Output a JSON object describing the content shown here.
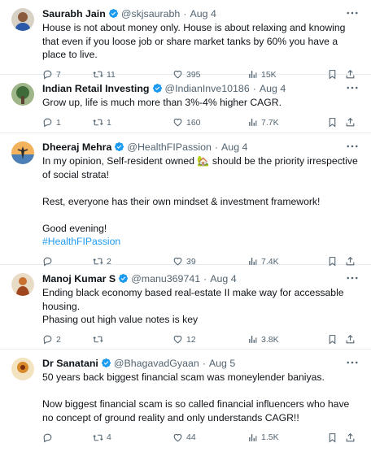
{
  "tweets": [
    {
      "name": "Saurabh Jain",
      "handle": "@skjsaurabh",
      "time": "Aug 4",
      "text": "House is not about money only. House is about relaxing and knowing that even if you loose job or share market tanks by 60% you have a place to live.",
      "replies": "7",
      "retweets": "11",
      "likes": "395",
      "views": "15K"
    },
    {
      "name": "Indian Retail Investing",
      "handle": "@IndianInve10186",
      "time": "Aug 4",
      "text": "Grow up, life is much more than 3%-4% higher CAGR.",
      "replies": "1",
      "retweets": "1",
      "likes": "160",
      "views": "7.7K"
    },
    {
      "name": "Dheeraj Mehra",
      "handle": "@HealthFIPassion",
      "time": "Aug 4",
      "text_part1": "In my opinion, Self-resident owned 🏡 should be the priority irrespective of social strata!\n\nRest, everyone has their own mindset & investment framework!\n\nGood evening!",
      "hashtag": "#HealthFIPassion",
      "replies": "",
      "retweets": "2",
      "likes": "39",
      "views": "7.4K"
    },
    {
      "name": "Manoj Kumar S",
      "handle": "@manu369741",
      "time": "Aug 4",
      "text": "Ending black economy based real-estate II make way for accessable housing.\nPhasing out high value notes is key",
      "replies": "2",
      "retweets": "",
      "likes": "12",
      "views": "3.8K"
    },
    {
      "name": "Dr Sanatani",
      "handle": "@BhagavadGyaan",
      "time": "Aug 5",
      "text": "50 years back biggest financial scam was moneylender baniyas.\n\nNow biggest financial scam is so called financial influencers who have no concept of ground reality and only understands CAGR!!",
      "replies": "",
      "retweets": "4",
      "likes": "44",
      "views": "1.5K"
    }
  ],
  "dot": "·",
  "colors": {
    "verified": "#1d9bf0",
    "muted": "#536471",
    "link": "#1d9bf0",
    "divider": "#e6ecf0"
  },
  "icons": [
    "more-icon",
    "reply-icon",
    "retweet-icon",
    "like-icon",
    "views-icon",
    "bookmark-icon",
    "share-icon",
    "verified-badge-icon"
  ]
}
